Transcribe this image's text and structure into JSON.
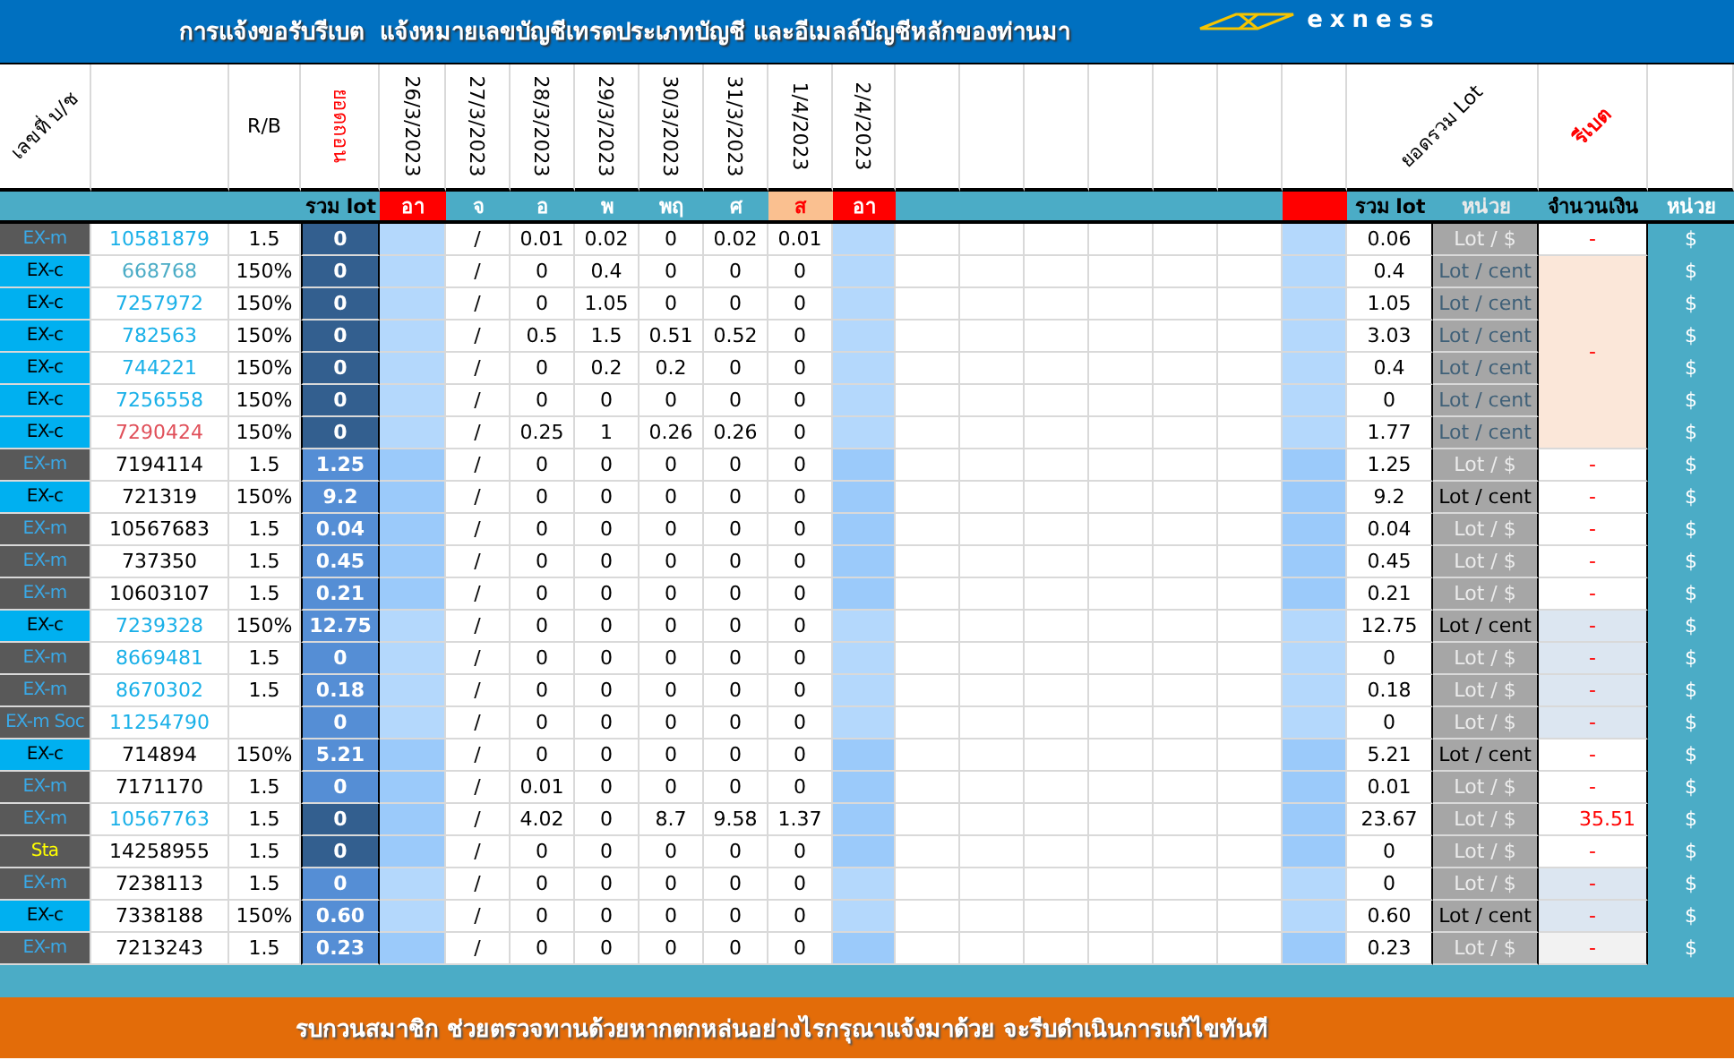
{
  "title": "การแจ้งขอรับรีเบต  แจ้งหมายเลขบัญชีเทรดประเภทบัญชี และอีเมลล์บัญชีหลักของท่านมา",
  "logo": {
    "text": "exness"
  },
  "header": {
    "account_label": "เลขที่ บ/ช",
    "rb_label": "R/B",
    "withdraw_label": "ยอดถอน",
    "dates": [
      "26/3/2023",
      "27/3/2023",
      "28/3/2023",
      "29/3/2023",
      "30/3/2023",
      "31/3/2023",
      "1/4/2023",
      "2/4/2023"
    ],
    "total_lot_label": "ยอดรวม Lot",
    "rebate_label": "รีเบต"
  },
  "subheader": {
    "sum_label": "รวม lot",
    "days": [
      {
        "label": "อา",
        "kind": "sunday"
      },
      {
        "label": "จ",
        "kind": "weekday"
      },
      {
        "label": "อ",
        "kind": "weekday"
      },
      {
        "label": "พ",
        "kind": "weekday"
      },
      {
        "label": "พฤ",
        "kind": "weekday"
      },
      {
        "label": "ศ",
        "kind": "weekday"
      },
      {
        "label": "ส",
        "kind": "saturday"
      },
      {
        "label": "อา",
        "kind": "sunday"
      }
    ],
    "right_sum_label": "รวม lot",
    "unit_label": "หน่วย",
    "amount_label": "จำนวนเงิน",
    "currency_label": "หน่วย"
  },
  "rows": [
    {
      "kind": "light",
      "type": {
        "text": "EX-m",
        "kind": "grey"
      },
      "account": {
        "text": "10581879",
        "color": "#1ab0e8"
      },
      "rb": "1.5",
      "total": {
        "text": "0",
        "kind": "dark"
      },
      "days": [
        "/",
        "0.01",
        "0.02",
        "0",
        "0.02",
        "0.01"
      ],
      "sum": "0.06",
      "unit": {
        "text": "Lot / $",
        "kind": "usd"
      },
      "amount": {
        "text": "-",
        "kind": "white"
      },
      "currency": "$"
    },
    {
      "kind": "light",
      "type": {
        "text": "EX-c",
        "kind": "cyan"
      },
      "account": {
        "text": "668768",
        "color": "#4bacc6"
      },
      "rb": "150%",
      "total": {
        "text": "0",
        "kind": "dark"
      },
      "days": [
        "/",
        "0",
        "0.4",
        "0",
        "0",
        "0"
      ],
      "sum": "0.4",
      "unit": {
        "text": "Lot / cent",
        "kind": "muted"
      },
      "amount": {
        "text": "-",
        "kind": "peach"
      },
      "currency": "$"
    },
    {
      "kind": "light",
      "type": {
        "text": "EX-c",
        "kind": "cyan"
      },
      "account": {
        "text": "7257972",
        "color": "#1ab0e8"
      },
      "rb": "150%",
      "total": {
        "text": "0",
        "kind": "dark"
      },
      "days": [
        "/",
        "0",
        "1.05",
        "0",
        "0",
        "0"
      ],
      "sum": "1.05",
      "unit": {
        "text": "Lot / cent",
        "kind": "muted"
      },
      "currency": "$"
    },
    {
      "kind": "light",
      "type": {
        "text": "EX-c",
        "kind": "cyan"
      },
      "account": {
        "text": "782563",
        "color": "#1ab0e8"
      },
      "rb": "150%",
      "total": {
        "text": "0",
        "kind": "dark"
      },
      "days": [
        "/",
        "0.5",
        "1.5",
        "0.51",
        "0.52",
        "0"
      ],
      "sum": "3.03",
      "unit": {
        "text": "Lot / cent",
        "kind": "muted"
      },
      "currency": "$"
    },
    {
      "kind": "light",
      "type": {
        "text": "EX-c",
        "kind": "cyan"
      },
      "account": {
        "text": "744221",
        "color": "#1ab0e8"
      },
      "rb": "150%",
      "total": {
        "text": "0",
        "kind": "dark"
      },
      "days": [
        "/",
        "0",
        "0.2",
        "0.2",
        "0",
        "0"
      ],
      "sum": "0.4",
      "unit": {
        "text": "Lot / cent",
        "kind": "muted"
      },
      "currency": "$"
    },
    {
      "kind": "light",
      "type": {
        "text": "EX-c",
        "kind": "cyan"
      },
      "account": {
        "text": "7256558",
        "color": "#1ab0e8"
      },
      "rb": "150%",
      "total": {
        "text": "0",
        "kind": "dark"
      },
      "days": [
        "/",
        "0",
        "0",
        "0",
        "0",
        "0"
      ],
      "sum": "0",
      "unit": {
        "text": "Lot / cent",
        "kind": "muted"
      },
      "currency": "$"
    },
    {
      "kind": "light",
      "type": {
        "text": "EX-c",
        "kind": "cyan"
      },
      "account": {
        "text": "7290424",
        "color": "#e0505a"
      },
      "rb": "150%",
      "total": {
        "text": "0",
        "kind": "dark"
      },
      "days": [
        "/",
        "0.25",
        "1",
        "0.26",
        "0.26",
        "0"
      ],
      "sum": "1.77",
      "unit": {
        "text": "Lot / cent",
        "kind": "muted"
      },
      "currency": "$"
    },
    {
      "kind": "deep",
      "type": {
        "text": "EX-m",
        "kind": "grey"
      },
      "account": {
        "text": "7194114",
        "color": "#000000"
      },
      "rb": "1.5",
      "total": {
        "text": "1.25",
        "kind": "medium"
      },
      "days": [
        "/",
        "0",
        "0",
        "0",
        "0",
        "0"
      ],
      "sum": "1.25",
      "unit": {
        "text": "Lot / $",
        "kind": "usd"
      },
      "amount": {
        "text": "-",
        "kind": "white"
      },
      "currency": "$"
    },
    {
      "kind": "deep",
      "type": {
        "text": "EX-c",
        "kind": "cyan"
      },
      "account": {
        "text": "721319",
        "color": "#000000"
      },
      "rb": "150%",
      "total": {
        "text": "9.2",
        "kind": "medium"
      },
      "days": [
        "/",
        "0",
        "0",
        "0",
        "0",
        "0"
      ],
      "sum": "9.2",
      "unit": {
        "text": "Lot / cent",
        "kind": "cent"
      },
      "amount": {
        "text": "-",
        "kind": "white"
      },
      "currency": "$"
    },
    {
      "kind": "deep",
      "type": {
        "text": "EX-m",
        "kind": "grey"
      },
      "account": {
        "text": "10567683",
        "color": "#000000"
      },
      "rb": "1.5",
      "total": {
        "text": "0.04",
        "kind": "medium"
      },
      "days": [
        "/",
        "0",
        "0",
        "0",
        "0",
        "0"
      ],
      "sum": "0.04",
      "unit": {
        "text": "Lot / $",
        "kind": "usd"
      },
      "amount": {
        "text": "-",
        "kind": "white"
      },
      "currency": "$"
    },
    {
      "kind": "deep",
      "type": {
        "text": "EX-m",
        "kind": "grey"
      },
      "account": {
        "text": "737350",
        "color": "#000000"
      },
      "rb": "1.5",
      "total": {
        "text": "0.45",
        "kind": "medium"
      },
      "days": [
        "/",
        "0",
        "0",
        "0",
        "0",
        "0"
      ],
      "sum": "0.45",
      "unit": {
        "text": "Lot / $",
        "kind": "usd"
      },
      "amount": {
        "text": "-",
        "kind": "white"
      },
      "currency": "$"
    },
    {
      "kind": "deep",
      "type": {
        "text": "EX-m",
        "kind": "grey"
      },
      "account": {
        "text": "10603107",
        "color": "#000000"
      },
      "rb": "1.5",
      "total": {
        "text": "0.21",
        "kind": "medium"
      },
      "days": [
        "/",
        "0",
        "0",
        "0",
        "0",
        "0"
      ],
      "sum": "0.21",
      "unit": {
        "text": "Lot / $",
        "kind": "usd"
      },
      "amount": {
        "text": "-",
        "kind": "white"
      },
      "currency": "$"
    },
    {
      "kind": "light",
      "type": {
        "text": "EX-c",
        "kind": "cyan"
      },
      "account": {
        "text": "7239328",
        "color": "#1ab0e8"
      },
      "rb": "150%",
      "total": {
        "text": "12.75",
        "kind": "medium"
      },
      "days": [
        "/",
        "0",
        "0",
        "0",
        "0",
        "0"
      ],
      "sum": "12.75",
      "unit": {
        "text": "Lot / cent",
        "kind": "cent"
      },
      "amount": {
        "text": "-",
        "kind": "bluegrey"
      },
      "currency": "$"
    },
    {
      "kind": "light",
      "type": {
        "text": "EX-m",
        "kind": "grey"
      },
      "account": {
        "text": "8669481",
        "color": "#1ab0e8"
      },
      "rb": "1.5",
      "total": {
        "text": "0",
        "kind": "medium"
      },
      "days": [
        "/",
        "0",
        "0",
        "0",
        "0",
        "0"
      ],
      "sum": "0",
      "unit": {
        "text": "Lot / $",
        "kind": "usd"
      },
      "amount": {
        "text": "-",
        "kind": "bluegrey"
      },
      "currency": "$"
    },
    {
      "kind": "light",
      "type": {
        "text": "EX-m",
        "kind": "grey"
      },
      "account": {
        "text": "8670302",
        "color": "#1ab0e8"
      },
      "rb": "1.5",
      "total": {
        "text": "0.18",
        "kind": "medium"
      },
      "days": [
        "/",
        "0",
        "0",
        "0",
        "0",
        "0"
      ],
      "sum": "0.18",
      "unit": {
        "text": "Lot / $",
        "kind": "usd"
      },
      "amount": {
        "text": "-",
        "kind": "bluegrey"
      },
      "currency": "$"
    },
    {
      "kind": "light",
      "type": {
        "text": "EX-m Soc",
        "kind": "grey"
      },
      "account": {
        "text": "11254790",
        "color": "#1ab0e8"
      },
      "total": {
        "text": "0",
        "kind": "medium"
      },
      "days": [
        "/",
        "0",
        "0",
        "0",
        "0",
        "0"
      ],
      "sum": "0",
      "unit": {
        "text": "Lot / $",
        "kind": "usd"
      },
      "amount": {
        "text": "-",
        "kind": "bluegrey"
      },
      "currency": "$"
    },
    {
      "kind": "deep",
      "type": {
        "text": "EX-c",
        "kind": "cyan"
      },
      "account": {
        "text": "714894",
        "color": "#000000"
      },
      "rb": "150%",
      "total": {
        "text": "5.21",
        "kind": "medium"
      },
      "days": [
        "/",
        "0",
        "0",
        "0",
        "0",
        "0"
      ],
      "sum": "5.21",
      "unit": {
        "text": "Lot / cent",
        "kind": "cent"
      },
      "amount": {
        "text": "-",
        "kind": "white"
      },
      "currency": "$"
    },
    {
      "kind": "deep",
      "type": {
        "text": "EX-m",
        "kind": "grey"
      },
      "account": {
        "text": "7171170",
        "color": "#000000"
      },
      "rb": "1.5",
      "total": {
        "text": "0",
        "kind": "medium"
      },
      "days": [
        "/",
        "0.01",
        "0",
        "0",
        "0",
        "0"
      ],
      "sum": "0.01",
      "unit": {
        "text": "Lot / $",
        "kind": "usd"
      },
      "amount": {
        "text": "-",
        "kind": "white"
      },
      "currency": "$"
    },
    {
      "kind": "deep",
      "type": {
        "text": "EX-m",
        "kind": "grey"
      },
      "account": {
        "text": "10567763",
        "color": "#1ab0e8"
      },
      "rb": "1.5",
      "total": {
        "text": "0",
        "kind": "dark"
      },
      "days": [
        "/",
        "4.02",
        "0",
        "8.7",
        "9.58",
        "1.37"
      ],
      "sum": "23.67",
      "unit": {
        "text": "Lot / $",
        "kind": "usd"
      },
      "amount": {
        "text": "35.51",
        "kind": "white"
      },
      "currency": "$"
    },
    {
      "kind": "deep",
      "type": {
        "text": "Sta",
        "kind": "yellow"
      },
      "account": {
        "text": "14258955",
        "color": "#000000"
      },
      "rb": "1.5",
      "total": {
        "text": "0",
        "kind": "dark"
      },
      "days": [
        "/",
        "0",
        "0",
        "0",
        "0",
        "0"
      ],
      "sum": "0",
      "unit": {
        "text": "Lot / $",
        "kind": "usd"
      },
      "amount": {
        "text": "-",
        "kind": "white"
      },
      "currency": "$"
    },
    {
      "kind": "light",
      "type": {
        "text": "EX-m",
        "kind": "grey"
      },
      "account": {
        "text": "7238113",
        "color": "#000000"
      },
      "rb": "1.5",
      "total": {
        "text": "0",
        "kind": "medium"
      },
      "days": [
        "/",
        "0",
        "0",
        "0",
        "0",
        "0"
      ],
      "sum": "0",
      "unit": {
        "text": "Lot / $",
        "kind": "usd"
      },
      "amount": {
        "text": "-",
        "kind": "bluegrey"
      },
      "currency": "$"
    },
    {
      "kind": "light",
      "type": {
        "text": "EX-c",
        "kind": "cyan"
      },
      "account": {
        "text": "7338188",
        "color": "#000000"
      },
      "rb": "150%",
      "total": {
        "text": "0.60",
        "kind": "medium"
      },
      "days": [
        "/",
        "0",
        "0",
        "0",
        "0",
        "0"
      ],
      "sum": "0.60",
      "unit": {
        "text": "Lot / cent",
        "kind": "cent"
      },
      "amount": {
        "text": "-",
        "kind": "bluegrey"
      },
      "currency": "$"
    },
    {
      "kind": "deep",
      "type": {
        "text": "EX-m",
        "kind": "grey"
      },
      "account": {
        "text": "7213243",
        "color": "#000000"
      },
      "rb": "1.5",
      "total": {
        "text": "0.23",
        "kind": "medium"
      },
      "days": [
        "/",
        "0",
        "0",
        "0",
        "0",
        "0"
      ],
      "sum": "0.23",
      "unit": {
        "text": "Lot / $",
        "kind": "usd"
      },
      "amount": {
        "text": "-",
        "kind": "lightgrey"
      },
      "currency": "$"
    }
  ],
  "footer": "รบกวนสมาชิก ช่วยตรวจทานด้วยหากตกหล่นอย่างไรกรุณาแจ้งมาด้วย จะรีบดำเนินการแก้ไขทันที"
}
